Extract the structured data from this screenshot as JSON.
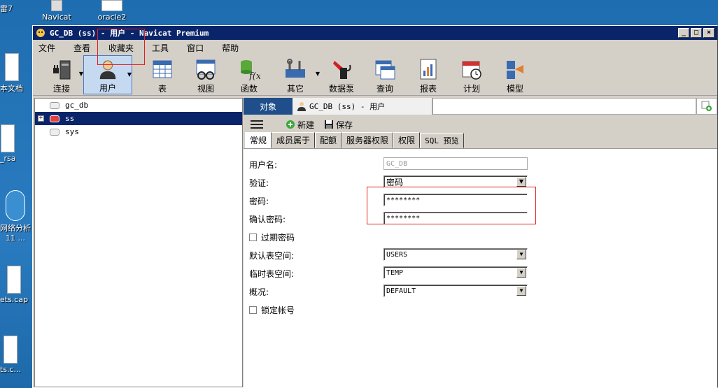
{
  "desktop": {
    "icons": [
      {
        "label": "雷7"
      },
      {
        "label": "Navicat"
      },
      {
        "label": "oracle2"
      },
      {
        "label": "本文档"
      },
      {
        "label": "_rsa"
      },
      {
        "label": "网络分析"
      },
      {
        "label": "11 ..."
      },
      {
        "label": "ets.cap"
      },
      {
        "label": "ts.c..."
      }
    ]
  },
  "window": {
    "title": "GC_DB (ss) - 用户 - Navicat Premium",
    "controls": {
      "minimize": "_",
      "maximize": "□",
      "close": "×"
    }
  },
  "menu": [
    "文件",
    "查看",
    "收藏夹",
    "工具",
    "窗口",
    "帮助"
  ],
  "toolbar": [
    {
      "label": "连接",
      "icon": "connection-icon"
    },
    {
      "label": "用户",
      "icon": "user-icon"
    },
    {
      "label": "表",
      "icon": "table-icon"
    },
    {
      "label": "视图",
      "icon": "view-icon"
    },
    {
      "label": "函数",
      "icon": "function-icon"
    },
    {
      "label": "其它",
      "icon": "other-icon"
    },
    {
      "label": "数据泵",
      "icon": "datapump-icon"
    },
    {
      "label": "查询",
      "icon": "query-icon"
    },
    {
      "label": "报表",
      "icon": "report-icon"
    },
    {
      "label": "计划",
      "icon": "schedule-icon"
    },
    {
      "label": "模型",
      "icon": "model-icon"
    }
  ],
  "tree": [
    {
      "label": "gc_db"
    },
    {
      "label": "ss"
    },
    {
      "label": "sys"
    }
  ],
  "tabs": {
    "objects": "对象",
    "user_tab": "GC_DB (ss) - 用户"
  },
  "subtoolbar": {
    "new": "新建",
    "save": "保存"
  },
  "prop_tabs": [
    "常规",
    "成员属于",
    "配额",
    "服务器权限",
    "权限",
    "SQL 预览"
  ],
  "form": {
    "username_label": "用户名:",
    "username_value": "GC_DB",
    "auth_label": "验证:",
    "auth_value": "密码",
    "password_label": "密码:",
    "password_value": "********",
    "confirm_label": "确认密码:",
    "confirm_value": "********",
    "expire_label": "过期密码",
    "default_ts_label": "默认表空间:",
    "default_ts_value": "USERS",
    "temp_ts_label": "临时表空间:",
    "temp_ts_value": "TEMP",
    "profile_label": "概况:",
    "profile_value": "DEFAULT",
    "lock_label": "锁定帐号"
  },
  "colors": {
    "accent": "#0a246a",
    "highlight": "#e02020"
  }
}
